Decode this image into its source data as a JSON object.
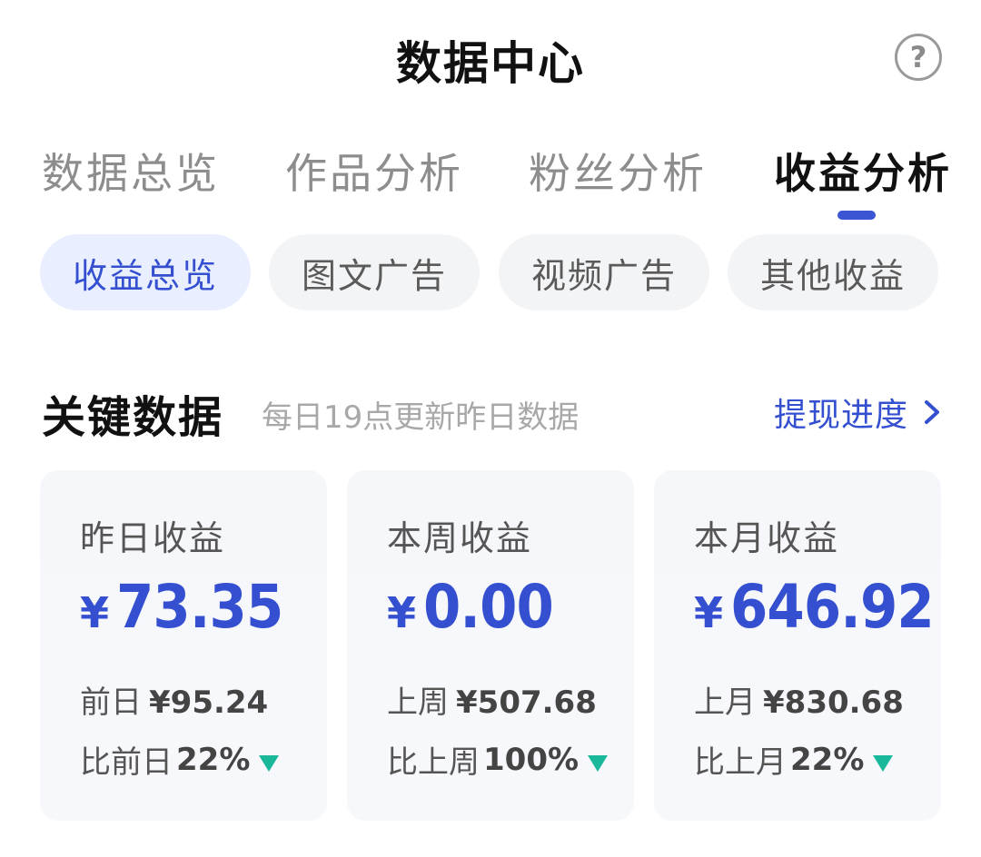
{
  "header": {
    "title": "数据中心",
    "help_icon": "question-circle-icon",
    "help_glyph": "?"
  },
  "main_tabs": [
    {
      "label": "数据总览",
      "active": false
    },
    {
      "label": "作品分析",
      "active": false
    },
    {
      "label": "粉丝分析",
      "active": false
    },
    {
      "label": "收益分析",
      "active": true
    }
  ],
  "sub_tabs": [
    {
      "label": "收益总览",
      "active": true
    },
    {
      "label": "图文广告",
      "active": false
    },
    {
      "label": "视频广告",
      "active": false
    },
    {
      "label": "其他收益",
      "active": false
    }
  ],
  "section": {
    "title": "关键数据",
    "subtitle": "每日19点更新昨日数据",
    "link_label": "提现进度",
    "link_icon": "chevron-right-icon"
  },
  "cards": [
    {
      "label": "昨日收益",
      "currency": "¥",
      "amount": "73.35",
      "prev_label": "前日",
      "prev_value": "¥95.24",
      "compare_label": "比前日",
      "compare_pct": "22%",
      "trend": "down"
    },
    {
      "label": "本周收益",
      "currency": "¥",
      "amount": "0.00",
      "prev_label": "上周",
      "prev_value": "¥507.68",
      "compare_label": "比上周",
      "compare_pct": "100%",
      "trend": "down"
    },
    {
      "label": "本月收益",
      "currency": "¥",
      "amount": "646.92",
      "prev_label": "上月",
      "prev_value": "¥830.68",
      "compare_label": "比上月",
      "compare_pct": "22%",
      "trend": "down"
    }
  ],
  "colors": {
    "accent": "#3450d0",
    "trend_down": "#19b89a",
    "chip_active_bg": "#e9efff",
    "chip_bg": "#f3f4f6"
  }
}
